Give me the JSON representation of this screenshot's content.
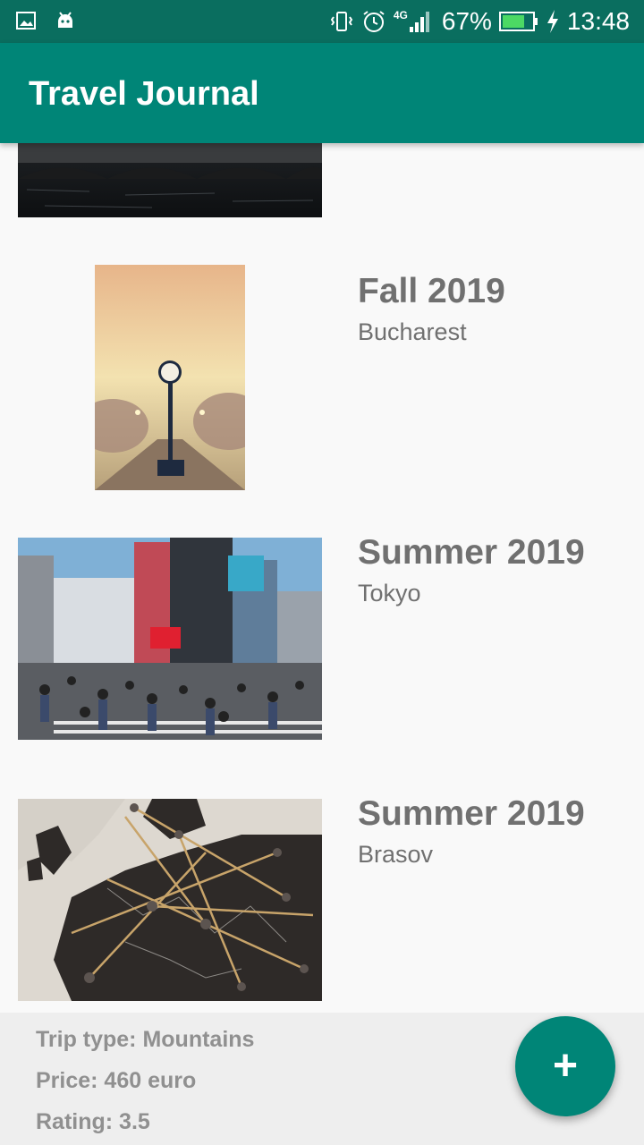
{
  "status_bar": {
    "network": "4G",
    "battery": "67%",
    "time": "13:48",
    "icons": [
      "image-icon",
      "android-icon",
      "vibrate-icon",
      "alarm-icon",
      "signal-icon",
      "battery-icon",
      "charging-icon"
    ]
  },
  "app_bar": {
    "title": "Travel Journal"
  },
  "trips": [
    {
      "title": "",
      "city": "",
      "image": "bridge-photo"
    },
    {
      "title": "Fall 2019",
      "city": "Bucharest",
      "image": "clock-street-photo"
    },
    {
      "title": "Summer 2019",
      "city": "Tokyo",
      "image": "tokyo-crossing-photo"
    },
    {
      "title": "Summer 2019",
      "city": "Brasov",
      "image": "europe-map-photo"
    }
  ],
  "details": {
    "trip_type": "Trip type: Mountains",
    "price": "Price: 460 euro",
    "rating": "Rating: 3.5"
  },
  "fab": {
    "label": "+",
    "icon": "add-icon",
    "color": "#008577"
  },
  "colors": {
    "primary": "#008577",
    "primary_dark": "#0a6e5f",
    "text_secondary": "#707070"
  }
}
